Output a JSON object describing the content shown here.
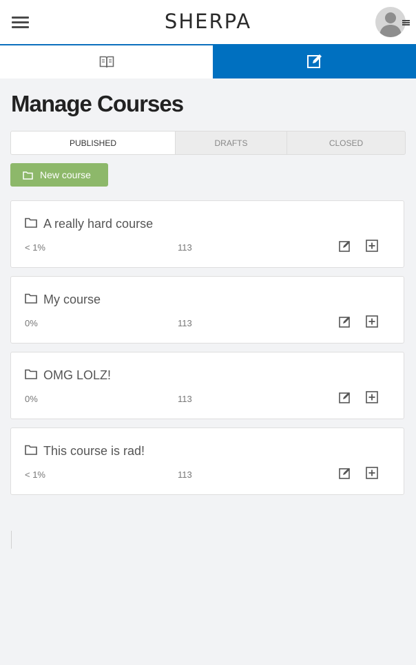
{
  "app": {
    "brand": "SHERPA"
  },
  "nav": {
    "tabs": [
      {
        "icon": "book-icon",
        "active": false
      },
      {
        "icon": "edit-icon",
        "active": true
      }
    ],
    "active_color": "#0070c0"
  },
  "page": {
    "title": "Manage Courses"
  },
  "status_tabs": [
    {
      "label": "PUBLISHED",
      "active": true
    },
    {
      "label": "DRAFTS",
      "active": false
    },
    {
      "label": "CLOSED",
      "active": false
    }
  ],
  "new_course": {
    "label": "New course",
    "icon": "folder-icon",
    "color": "#8db86a"
  },
  "courses": [
    {
      "title": "A really hard course",
      "progress": "< 1%",
      "count": "113"
    },
    {
      "title": "My course",
      "progress": "0%",
      "count": "113"
    },
    {
      "title": "OMG LOLZ!",
      "progress": "0%",
      "count": "113"
    },
    {
      "title": "This course is rad!",
      "progress": "< 1%",
      "count": "113"
    }
  ]
}
